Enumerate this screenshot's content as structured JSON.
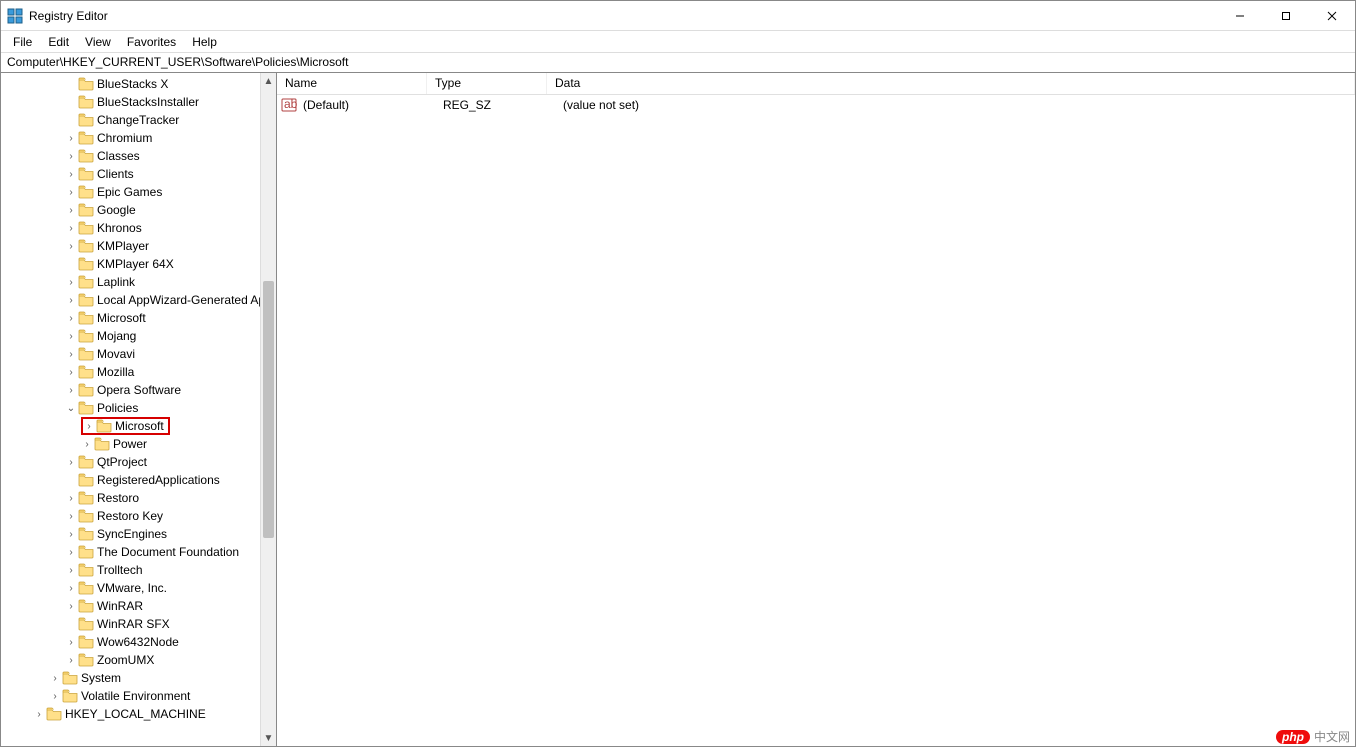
{
  "window": {
    "title": "Registry Editor"
  },
  "menu": {
    "file": "File",
    "edit": "Edit",
    "view": "View",
    "favorites": "Favorites",
    "help": "Help"
  },
  "address": "Computer\\HKEY_CURRENT_USER\\Software\\Policies\\Microsoft",
  "tree": {
    "items": [
      {
        "label": "BlueStacks X",
        "depth": 4,
        "caret": ""
      },
      {
        "label": "BlueStacksInstaller",
        "depth": 4,
        "caret": ""
      },
      {
        "label": "ChangeTracker",
        "depth": 4,
        "caret": ""
      },
      {
        "label": "Chromium",
        "depth": 4,
        "caret": ">"
      },
      {
        "label": "Classes",
        "depth": 4,
        "caret": ">"
      },
      {
        "label": "Clients",
        "depth": 4,
        "caret": ">"
      },
      {
        "label": "Epic Games",
        "depth": 4,
        "caret": ">"
      },
      {
        "label": "Google",
        "depth": 4,
        "caret": ">"
      },
      {
        "label": "Khronos",
        "depth": 4,
        "caret": ">"
      },
      {
        "label": "KMPlayer",
        "depth": 4,
        "caret": ">"
      },
      {
        "label": "KMPlayer 64X",
        "depth": 4,
        "caret": ""
      },
      {
        "label": "Laplink",
        "depth": 4,
        "caret": ">"
      },
      {
        "label": "Local AppWizard-Generated Applications",
        "depth": 4,
        "caret": ">"
      },
      {
        "label": "Microsoft",
        "depth": 4,
        "caret": ">"
      },
      {
        "label": "Mojang",
        "depth": 4,
        "caret": ">"
      },
      {
        "label": "Movavi",
        "depth": 4,
        "caret": ">"
      },
      {
        "label": "Mozilla",
        "depth": 4,
        "caret": ">"
      },
      {
        "label": "Opera Software",
        "depth": 4,
        "caret": ">"
      },
      {
        "label": "Policies",
        "depth": 4,
        "caret": "v"
      },
      {
        "label": "Microsoft",
        "depth": 5,
        "caret": ">",
        "selected": true
      },
      {
        "label": "Power",
        "depth": 5,
        "caret": ">"
      },
      {
        "label": "QtProject",
        "depth": 4,
        "caret": ">"
      },
      {
        "label": "RegisteredApplications",
        "depth": 4,
        "caret": ""
      },
      {
        "label": "Restoro",
        "depth": 4,
        "caret": ">"
      },
      {
        "label": "Restoro Key",
        "depth": 4,
        "caret": ">"
      },
      {
        "label": "SyncEngines",
        "depth": 4,
        "caret": ">"
      },
      {
        "label": "The Document Foundation",
        "depth": 4,
        "caret": ">"
      },
      {
        "label": "Trolltech",
        "depth": 4,
        "caret": ">"
      },
      {
        "label": "VMware, Inc.",
        "depth": 4,
        "caret": ">"
      },
      {
        "label": "WinRAR",
        "depth": 4,
        "caret": ">"
      },
      {
        "label": "WinRAR SFX",
        "depth": 4,
        "caret": ""
      },
      {
        "label": "Wow6432Node",
        "depth": 4,
        "caret": ">"
      },
      {
        "label": "ZoomUMX",
        "depth": 4,
        "caret": ">"
      },
      {
        "label": "System",
        "depth": 3,
        "caret": ">"
      },
      {
        "label": "Volatile Environment",
        "depth": 3,
        "caret": ">"
      },
      {
        "label": "HKEY_LOCAL_MACHINE",
        "depth": 2,
        "caret": ">"
      }
    ]
  },
  "list": {
    "headers": {
      "name": "Name",
      "type": "Type",
      "data": "Data"
    },
    "rows": [
      {
        "name": "(Default)",
        "type": "REG_SZ",
        "data": "(value not set)"
      }
    ]
  },
  "watermark": {
    "brand": "php",
    "text": "中文网"
  }
}
